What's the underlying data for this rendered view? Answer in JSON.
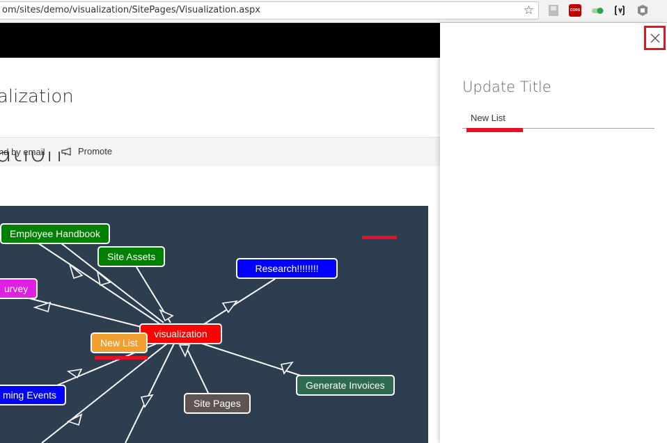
{
  "browser": {
    "url": "om/sites/demo/visualization/SitePages/Visualization.aspx",
    "extensions": [
      "bookmark-icon",
      "cors-icon",
      "toggle-icon",
      "bracket-icon",
      "shield-icon"
    ],
    "cors_label": "CORS"
  },
  "site": {
    "title": "alization",
    "page_heading": "ation"
  },
  "commands": {
    "send_by_email": "nd by email",
    "promote": "Promote"
  },
  "visualization": {
    "background": "#2c3e50",
    "nodes": [
      {
        "id": "employee-handbook",
        "label": "Employee Handbook",
        "color": "#008000"
      },
      {
        "id": "site-assets",
        "label": "Site Assets",
        "color": "#008000"
      },
      {
        "id": "research",
        "label": "Research!!!!!!!!",
        "color": "#0000ff"
      },
      {
        "id": "survey",
        "label": "urvey",
        "color": "#e020e0"
      },
      {
        "id": "visualization",
        "label": "visualization",
        "color": "#ff0000"
      },
      {
        "id": "new-list",
        "label": "New List",
        "color": "#f0a030"
      },
      {
        "id": "upcoming-events",
        "label": "ming Events",
        "color": "#0000ff"
      },
      {
        "id": "generate-invoices",
        "label": "Generate Invoices",
        "color": "#2e6b4e"
      },
      {
        "id": "site-pages",
        "label": "Site Pages",
        "color": "#5e5552"
      }
    ]
  },
  "panel": {
    "title": "Update Title",
    "input_value": "New List",
    "accent": "#e81123"
  }
}
